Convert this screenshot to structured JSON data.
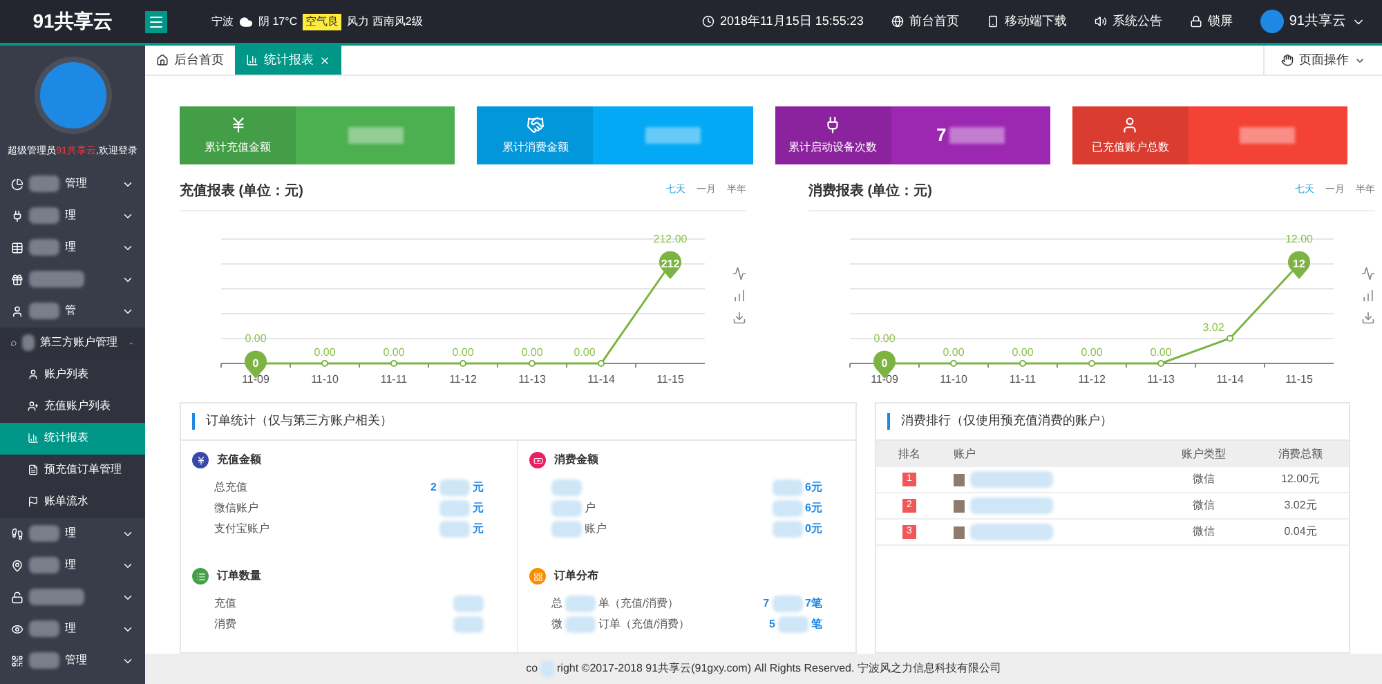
{
  "header": {
    "brand": "91共享云",
    "weather": {
      "city": "宁波",
      "condition": "阴 17°C",
      "air": "空气良",
      "wind": "风力 西南风2级"
    },
    "datetime": "2018年11月15日 15:55:23",
    "links": [
      {
        "kind": "globe",
        "label": "前台首页"
      },
      {
        "kind": "mobile",
        "label": "移动端下载"
      },
      {
        "kind": "speaker",
        "label": "系统公告"
      },
      {
        "kind": "lock",
        "label": "锁屏"
      }
    ],
    "user": "91共享云"
  },
  "sidebar": {
    "welcome": {
      "prefix": "超级管理员",
      "name": "91共享云",
      "suffix": ",欢迎登录"
    },
    "items": [
      {
        "label": "管理",
        "expanded": false
      },
      {
        "label": "理",
        "expanded": false
      },
      {
        "label": "理",
        "expanded": false
      },
      {
        "expanded": false
      },
      {
        "label": "管",
        "expanded": false
      },
      {
        "label": "第三方账户管理",
        "expanded": true,
        "children": [
          {
            "label": "账户列表",
            "selected": false
          },
          {
            "label": "充值账户列表",
            "selected": false
          },
          {
            "label": "统计报表",
            "selected": true
          },
          {
            "label": "预充值订单管理",
            "selected": false
          },
          {
            "label": "账单流水",
            "selected": false
          }
        ]
      },
      {
        "label": "理",
        "expanded": false
      },
      {
        "label": "理",
        "expanded": false
      },
      {
        "expanded": false
      },
      {
        "label": "理",
        "expanded": false
      },
      {
        "label": "管理",
        "expanded": false
      }
    ]
  },
  "tabs": [
    {
      "label": "后台首页",
      "selected": false,
      "closable": false
    },
    {
      "label": "统计报表",
      "selected": true,
      "closable": true
    }
  ],
  "page_actions": "页面操作",
  "cards": [
    {
      "kind": "yen",
      "label": "累计充值金额",
      "color": "#4caf50"
    },
    {
      "kind": "handshake",
      "label": "累计消费金额",
      "color": "#03a9f4"
    },
    {
      "kind": "plug",
      "label": "累计启动设备次数",
      "value": "7",
      "color": "#9c27b0"
    },
    {
      "kind": "user",
      "label": "已充值账户总数",
      "color": "#f44336"
    }
  ],
  "charts": [
    {
      "title": "充值报表 (单位：元)",
      "ranges": [
        {
          "label": "七天",
          "selected": true
        },
        {
          "label": "一月",
          "selected": false
        },
        {
          "label": "半年",
          "selected": false
        }
      ],
      "chart_data": {
        "type": "line",
        "categories": [
          "11-09",
          "11-10",
          "11-11",
          "11-12",
          "11-13",
          "11-14",
          "11-15"
        ],
        "series": [
          {
            "color": "#7cb342",
            "marker": "o",
            "values": [
              0,
              0,
              0,
              0,
              0,
              0,
              212
            ],
            "value_labels": [
              "0.00",
              "0.00",
              "0.00",
              "0.00",
              "0.00",
              "0.00",
              "212.00"
            ]
          }
        ],
        "annotations": [
          "0",
          "212"
        ]
      }
    },
    {
      "title": "消费报表 (单位：元)",
      "ranges": [
        {
          "label": "七天",
          "selected": true
        },
        {
          "label": "一月",
          "selected": false
        },
        {
          "label": "半年",
          "selected": false
        }
      ],
      "chart_data": {
        "type": "line",
        "categories": [
          "11-09",
          "11-10",
          "11-11",
          "11-12",
          "11-13",
          "11-14",
          "11-15"
        ],
        "series": [
          {
            "color": "#7cb342",
            "marker": "o",
            "values": [
              0,
              0,
              0,
              0,
              0,
              3.02,
              12
            ],
            "value_labels": [
              "0.00",
              "0.00",
              "0.00",
              "0.00",
              "0.00",
              "3.02",
              "12.00"
            ]
          }
        ],
        "annotations": [
          "0",
          "12"
        ]
      }
    }
  ],
  "order_stats": {
    "title": "订单统计（仅与第三方账户相关）",
    "sections": [
      {
        "kind": "yen",
        "title": "充值金额",
        "color": "#3949ab",
        "rows": [
          {
            "label": [
              {
                "kind": "text",
                "text": "总充值"
              }
            ],
            "value": [
              {
                "kind": "text",
                "text": "2"
              },
              {
                "kind": "blur"
              },
              {
                "kind": "text",
                "text": "元"
              }
            ]
          },
          {
            "label": [
              {
                "kind": "text",
                "text": "微信账户"
              }
            ],
            "value": [
              {
                "kind": "blur"
              },
              {
                "kind": "text",
                "text": "元"
              }
            ]
          },
          {
            "label": [
              {
                "kind": "text",
                "text": "支付宝账户"
              }
            ],
            "value": [
              {
                "kind": "blur"
              },
              {
                "kind": "text",
                "text": "元"
              }
            ]
          }
        ]
      },
      {
        "kind": "money",
        "title": "消费金额",
        "color": "#e91e63",
        "rows": [
          {
            "label": [
              {
                "kind": "blur"
              }
            ],
            "value": [
              {
                "kind": "blur"
              },
              {
                "kind": "text",
                "text": "6元"
              }
            ]
          },
          {
            "label": [
              {
                "kind": "blur"
              },
              {
                "kind": "text",
                "text": "户"
              }
            ],
            "value": [
              {
                "kind": "blur"
              },
              {
                "kind": "text",
                "text": "6元"
              }
            ]
          },
          {
            "label": [
              {
                "kind": "blur"
              },
              {
                "kind": "text",
                "text": "账户"
              }
            ],
            "value": [
              {
                "kind": "blur"
              },
              {
                "kind": "text",
                "text": "0元"
              }
            ]
          }
        ]
      },
      {
        "kind": "list",
        "title": "订单数量",
        "color": "#43a047",
        "rows": [
          {
            "label": [
              {
                "kind": "text",
                "text": "充值"
              }
            ],
            "value": [
              {
                "kind": "blur"
              }
            ]
          },
          {
            "label": [
              {
                "kind": "text",
                "text": "消费"
              }
            ],
            "value": [
              {
                "kind": "blur"
              }
            ]
          }
        ]
      },
      {
        "kind": "grid",
        "title": "订单分布",
        "color": "#fb8c00",
        "rows": [
          {
            "label": [
              {
                "kind": "text",
                "text": "总"
              },
              {
                "kind": "blur"
              },
              {
                "kind": "text",
                "text": "单（充值/消费）"
              }
            ],
            "value": [
              {
                "kind": "text",
                "text": "7"
              },
              {
                "kind": "blur"
              },
              {
                "kind": "text",
                "text": "7笔"
              }
            ]
          },
          {
            "label": [
              {
                "kind": "text",
                "text": "微"
              },
              {
                "kind": "blur"
              },
              {
                "kind": "text",
                "text": "订单（充值/消费）"
              }
            ],
            "value": [
              {
                "kind": "text",
                "text": "5"
              },
              {
                "kind": "blur"
              },
              {
                "kind": "text",
                "text": "笔"
              }
            ]
          }
        ]
      }
    ]
  },
  "ranking": {
    "title": "消费排行（仅使用预充值消费的账户）",
    "columns": [
      "排名",
      "账户",
      "账户类型",
      "消费总额"
    ],
    "rows": [
      {
        "rank": "1",
        "type": "微信",
        "amount": "12.00元"
      },
      {
        "rank": "2",
        "type": "微信",
        "amount": "3.02元"
      },
      {
        "rank": "3",
        "type": "微信",
        "amount": "0.04元"
      }
    ]
  },
  "footer": {
    "before": "co",
    "after": "right ©2017-2018 91共享云(91gxy.com) All Rights Reserved. 宁波风之力信息科技有限公司"
  }
}
